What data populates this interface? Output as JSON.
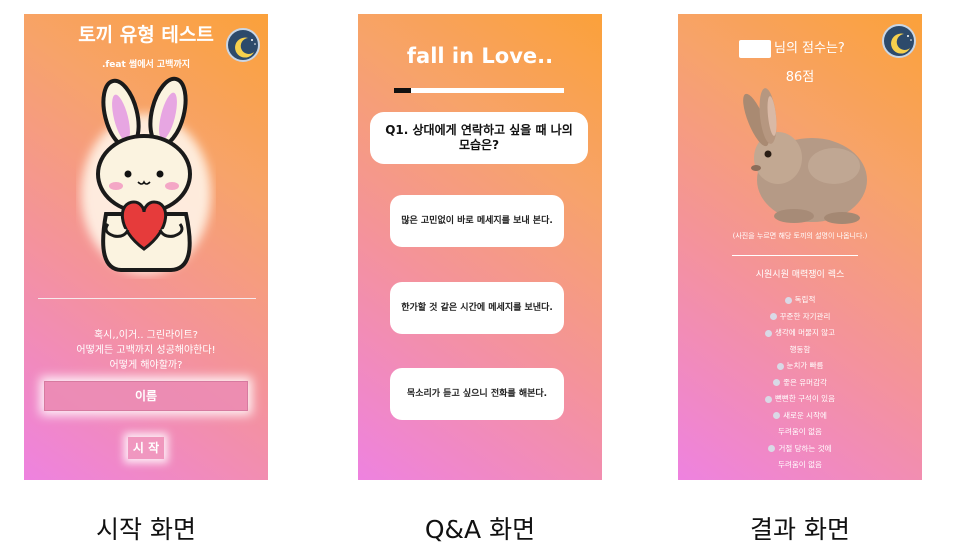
{
  "start_screen": {
    "title": "토끼 유형 테스트",
    "subtitle": ".feat 썸에서 고백까지",
    "desc_lines": [
      "혹시,,이거.. 그린라이트?",
      "어떻게든 고백까지 성공해야한다!",
      "어떻게 해야할까?"
    ],
    "name_placeholder": "이름",
    "start_label": "시 작",
    "caption": "시작 화면"
  },
  "qa_screen": {
    "title": "fall in Love..",
    "progress": 0.1,
    "question": "Q1. 상대에게 연락하고 싶을 때 나의 모습은?",
    "answers": [
      "많은 고민없이 바로 메세지를 보내 본다.",
      "한가할 것 같은 시간에 메세지를 보낸다.",
      "목소리가 듣고 싶으니 전화를 해본다."
    ],
    "caption": "Q&A 화면"
  },
  "result_screen": {
    "score_title": "님의 점수는?",
    "score": "86점",
    "hint": "(사진을 누르면 해당 토끼의 설명이 나옵니다.)",
    "type": "시원시원 매력쟁이 렉스",
    "traits": [
      "독립적",
      "꾸준한 자기관리",
      "생각에 머물지 않고",
      "행동함",
      "눈치가 빠름",
      "좋은 유머감각",
      "뻔뻔한 구석이 있음",
      "새로운 시작에",
      "두려움이 없음",
      "거절 당하는 것에",
      "두려움이 없음"
    ],
    "caption": "결과 화면"
  },
  "icons": {
    "theme_toggle": "moon-icon",
    "trait_bullet": "rabbit-face-icon"
  },
  "colors": {
    "gradient_pink": "#ee82e0",
    "gradient_orange": "#fba13a",
    "moon_bg": "#2d4a6b"
  }
}
